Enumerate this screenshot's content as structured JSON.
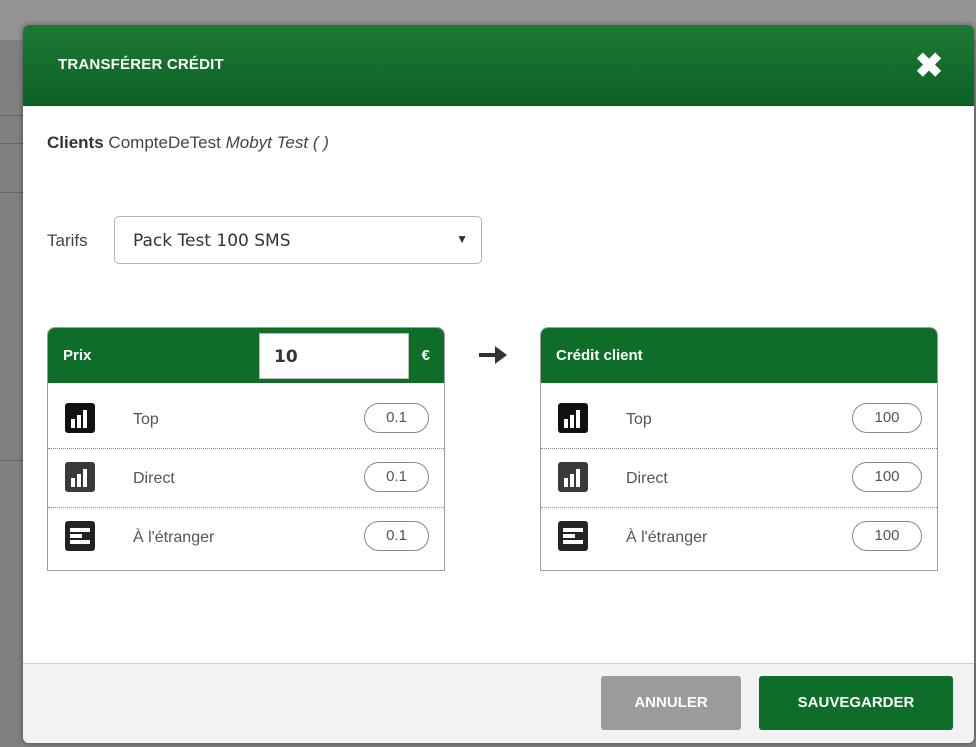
{
  "modal": {
    "title": "TRANSFÉRER CRÉDIT",
    "close_glyph": "✖"
  },
  "clients": {
    "label": "Clients",
    "account": "CompteDeTest",
    "name": "Mobyt Test ( )"
  },
  "tarifs": {
    "label": "Tarifs",
    "selected": "Pack Test 100 SMS",
    "caret": "▼"
  },
  "prix_panel": {
    "title": "Prix",
    "input_value": "10",
    "currency": "€",
    "rows": [
      {
        "icon": "signal-bars-icon",
        "label": "Top",
        "value": "0.1"
      },
      {
        "icon": "signal-bars-icon",
        "label": "Direct",
        "value": "0.1"
      },
      {
        "icon": "foreign-icon",
        "label": "À l'étranger",
        "value": "0.1"
      }
    ]
  },
  "credit_panel": {
    "title": "Crédit client",
    "rows": [
      {
        "icon": "signal-bars-icon",
        "label": "Top",
        "value": "100"
      },
      {
        "icon": "signal-bars-icon",
        "label": "Direct",
        "value": "100"
      },
      {
        "icon": "foreign-icon",
        "label": "À l'étranger",
        "value": "100"
      }
    ]
  },
  "footer": {
    "cancel_label": "ANNULER",
    "save_label": "SAUVEGARDER"
  },
  "colors": {
    "primary_green": "#0e6d28",
    "cancel_gray": "#9b9b9b"
  }
}
